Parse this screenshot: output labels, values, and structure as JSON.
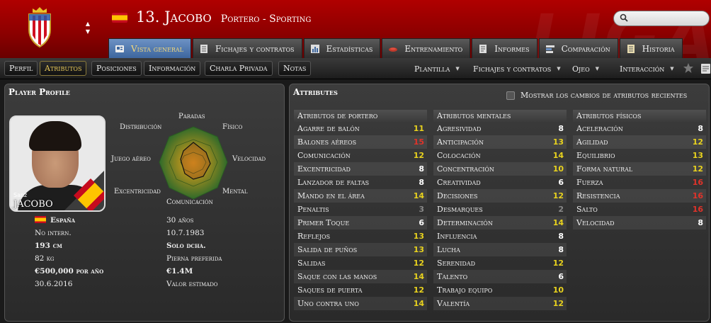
{
  "header": {
    "player_number_name": "13. Jacobo",
    "position_club": "Portero - Sporting",
    "search_placeholder": "",
    "watermark": "LIGA"
  },
  "tabs": [
    {
      "label": "Vista general",
      "icon": "overview-icon",
      "active": true
    },
    {
      "label": "Fichajes y contratos",
      "icon": "document-icon",
      "active": false
    },
    {
      "label": "Estadísticas",
      "icon": "stats-icon",
      "active": false
    },
    {
      "label": "Entrenamiento",
      "icon": "training-icon",
      "active": false
    },
    {
      "label": "Informes",
      "icon": "report-icon",
      "active": false
    },
    {
      "label": "Comparación",
      "icon": "compare-icon",
      "active": false
    },
    {
      "label": "Historia",
      "icon": "history-icon",
      "active": false
    }
  ],
  "subnav": {
    "buttons": [
      "Perfil",
      "Atributos",
      "Posiciones",
      "Información",
      "Charla Privada",
      "Notas"
    ],
    "active": "Atributos",
    "dropdowns": [
      "Plantilla",
      "Fichajes y contratos",
      "Ojeo",
      "Interacción"
    ]
  },
  "profile": {
    "title": "Player Profile",
    "first_name": "Sanz",
    "last_name": "JACOBO",
    "radar_labels": {
      "top": "Paradas",
      "top_right": "Físico",
      "right": "Velocidad",
      "bottom_right": "Mental",
      "bottom": "Comunicación",
      "bottom_left": "Excentricidad",
      "left": "Juego aéreo",
      "top_left": "Distribución"
    },
    "info": [
      {
        "left": "España",
        "right": "30 años"
      },
      {
        "left": "No intern.",
        "right": "10.7.1983"
      },
      {
        "left": "193 cm",
        "right": "Solo dcha."
      },
      {
        "left": "82 kg",
        "right": "Pierna preferida"
      },
      {
        "left": "€500,000 por año",
        "right": "€1.4M"
      },
      {
        "left": "30.6.2016",
        "right": "Valor estimado"
      }
    ]
  },
  "attributes": {
    "title": "Attributes",
    "toggle_label": "Mostrar los cambios de atributos recientes",
    "columns": [
      {
        "heading": "Atributos de portero",
        "rows": [
          {
            "name": "Agarre de balón",
            "value": "11",
            "color": "#e8d21e"
          },
          {
            "name": "Balones aéreos",
            "value": "15",
            "color": "#e0332a"
          },
          {
            "name": "Comunicación",
            "value": "12",
            "color": "#e8d21e"
          },
          {
            "name": "Excentricidad",
            "value": "8",
            "color": "#ffffff"
          },
          {
            "name": "Lanzador de faltas",
            "value": "8",
            "color": "#ffffff"
          },
          {
            "name": "Mando en el área",
            "value": "14",
            "color": "#e8d21e"
          },
          {
            "name": "Penaltis",
            "value": "3",
            "color": "#888888"
          },
          {
            "name": "Primer Toque",
            "value": "6",
            "color": "#ffffff"
          },
          {
            "name": "Reflejos",
            "value": "13",
            "color": "#e8d21e"
          },
          {
            "name": "Salida de puños",
            "value": "13",
            "color": "#e8d21e"
          },
          {
            "name": "Salidas",
            "value": "12",
            "color": "#e8d21e"
          },
          {
            "name": "Saque con las manos",
            "value": "14",
            "color": "#e8d21e"
          },
          {
            "name": "Saques de puerta",
            "value": "12",
            "color": "#e8d21e"
          },
          {
            "name": "Uno contra uno",
            "value": "14",
            "color": "#e8d21e"
          }
        ]
      },
      {
        "heading": "Atributos mentales",
        "rows": [
          {
            "name": "Agresividad",
            "value": "8",
            "color": "#ffffff"
          },
          {
            "name": "Anticipación",
            "value": "13",
            "color": "#e8d21e"
          },
          {
            "name": "Colocación",
            "value": "14",
            "color": "#e8d21e"
          },
          {
            "name": "Concentración",
            "value": "10",
            "color": "#e8d21e"
          },
          {
            "name": "Creatividad",
            "value": "6",
            "color": "#ffffff"
          },
          {
            "name": "Decisiones",
            "value": "12",
            "color": "#e8d21e"
          },
          {
            "name": "Desmarques",
            "value": "2",
            "color": "#888888"
          },
          {
            "name": "Determinación",
            "value": "14",
            "color": "#e8d21e"
          },
          {
            "name": "Influencia",
            "value": "8",
            "color": "#ffffff"
          },
          {
            "name": "Lucha",
            "value": "8",
            "color": "#ffffff"
          },
          {
            "name": "Serenidad",
            "value": "12",
            "color": "#e8d21e"
          },
          {
            "name": "Talento",
            "value": "6",
            "color": "#ffffff"
          },
          {
            "name": "Trabajo equipo",
            "value": "10",
            "color": "#e8d21e"
          },
          {
            "name": "Valentía",
            "value": "12",
            "color": "#e8d21e"
          }
        ]
      },
      {
        "heading": "Atributos físicos",
        "rows": [
          {
            "name": "Aceleración",
            "value": "8",
            "color": "#ffffff"
          },
          {
            "name": "Agilidad",
            "value": "12",
            "color": "#e8d21e"
          },
          {
            "name": "Equilibrio",
            "value": "13",
            "color": "#e8d21e"
          },
          {
            "name": "Forma natural",
            "value": "12",
            "color": "#e8d21e"
          },
          {
            "name": "Fuerza",
            "value": "16",
            "color": "#e0332a"
          },
          {
            "name": "Resistencia",
            "value": "16",
            "color": "#e0332a"
          },
          {
            "name": "Salto",
            "value": "16",
            "color": "#e0332a"
          },
          {
            "name": "Velocidad",
            "value": "8",
            "color": "#ffffff"
          }
        ]
      }
    ]
  }
}
